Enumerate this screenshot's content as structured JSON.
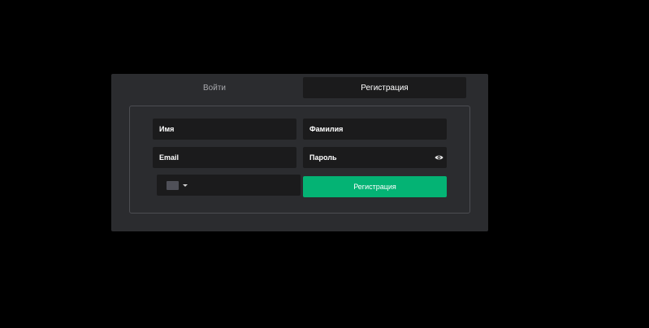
{
  "tabs": {
    "login_label": "Войти",
    "register_label": "Регистрация",
    "active": "register"
  },
  "form": {
    "first_name": {
      "placeholder": "Имя",
      "value": ""
    },
    "last_name": {
      "placeholder": "Фамилия",
      "value": ""
    },
    "email": {
      "placeholder": "Email",
      "value": ""
    },
    "password": {
      "placeholder": "Пароль",
      "value": "",
      "toggle_icon": "eye-icon"
    },
    "phone": {
      "value": "",
      "country_icon": "flag-placeholder",
      "dropdown_icon": "chevron-down-icon"
    },
    "submit_label": "Регистрация"
  },
  "colors": {
    "background": "#000000",
    "panel": "#2b2c2f",
    "field": "#1b1b1c",
    "accent": "#04b374",
    "border": "#4c4d52"
  }
}
